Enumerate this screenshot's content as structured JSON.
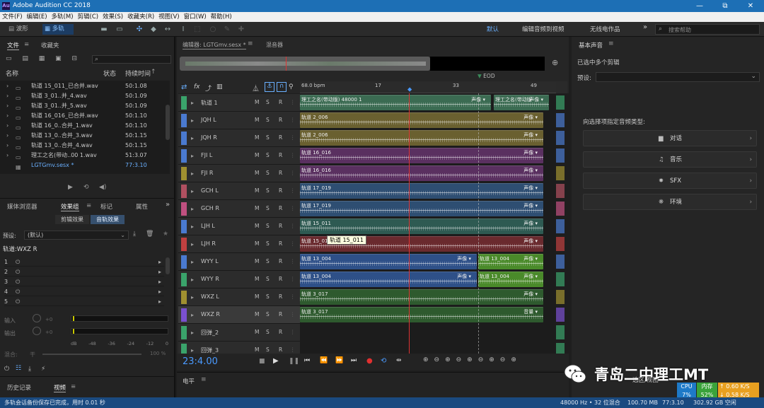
{
  "window": {
    "title": "Adobe Audition CC 2018",
    "app_icon": "Au",
    "minimize": "—",
    "restore": "⧉",
    "close": "✕"
  },
  "menu": [
    "文件(F)",
    "编辑(E)",
    "多轨(M)",
    "剪辑(C)",
    "效果(S)",
    "收藏夹(R)",
    "视图(V)",
    "窗口(W)",
    "帮助(H)"
  ],
  "toolbar": {
    "waveform": "波形",
    "multitrack": "多轨"
  },
  "workspace": {
    "default": "默认",
    "edit_video": "编辑音频到视频",
    "radio": "无线电作品",
    "more": "»",
    "search_placeholder": "搜索帮助"
  },
  "files_panel": {
    "tab_files": "文件",
    "tab_favorites": "收藏夹",
    "col_name": "名称",
    "col_status": "状态",
    "col_duration": "持续时间",
    "items": [
      {
        "name": "轨道 15_011_已合并.wav",
        "duration": "50:1.08"
      },
      {
        "name": "轨道 3_01..并_4.wav",
        "duration": "50:1.09"
      },
      {
        "name": "轨道 3_01..并_5.wav",
        "duration": "50:1.09"
      },
      {
        "name": "轨道 16_016_已合并.wav",
        "duration": "50:1.10"
      },
      {
        "name": "轨道 16_0..合并_1.wav",
        "duration": "50:1.10"
      },
      {
        "name": "轨道 13_0..合并_3.wav",
        "duration": "50:1.15"
      },
      {
        "name": "轨道 13_0..合并_4.wav",
        "duration": "50:1.15"
      },
      {
        "name": "理工之名(带动..00 1.wav",
        "duration": "51:3.07"
      },
      {
        "name": "LGTGmv.sesx *",
        "duration": "77:3.10"
      }
    ]
  },
  "effects_panel": {
    "tab_media": "媒体浏览器",
    "tab_effects": "效果组",
    "tab_markers": "标记",
    "tab_props": "属性",
    "sub_clip": "剪辑效果",
    "sub_track": "音轨效果",
    "preset_label": "预设:",
    "preset_value": "(默认)",
    "track_label": "轨道:WXZ R",
    "slots": [
      "1",
      "2",
      "3",
      "4",
      "5"
    ],
    "input_label": "输入",
    "output_label": "输出",
    "mix_label": "混合:",
    "mix_dry": "干",
    "mix_pct": "100 %",
    "db_ticks": [
      "dB",
      "-48",
      "-36",
      "-24",
      "-12",
      "0"
    ],
    "db_zero": "+0"
  },
  "history_panel": {
    "tab_history": "历史记录",
    "tab_video": "视频"
  },
  "editor": {
    "tab_editor": "编辑器: LGTGmv.sesx *",
    "tab_mixer": "混音器",
    "bpm": "68.0 bpm",
    "ruler": [
      "17",
      "33",
      "49"
    ],
    "eod": "EOD",
    "time": "23:4.00",
    "tooltip": "轨道 15_011"
  },
  "tracks": [
    {
      "name": "轨道 1",
      "color": "#3aa36b"
    },
    {
      "name": "JQH L",
      "color": "#4a7ad0"
    },
    {
      "name": "JQH R",
      "color": "#4a7ad0"
    },
    {
      "name": "FJI L",
      "color": "#4a7ad0"
    },
    {
      "name": "FJI R",
      "color": "#a09030"
    },
    {
      "name": "GCH L",
      "color": "#b05060"
    },
    {
      "name": "GCH R",
      "color": "#c05080"
    },
    {
      "name": "LJH L",
      "color": "#4a7ad0"
    },
    {
      "name": "LJH R",
      "color": "#c04040"
    },
    {
      "name": "WYY L",
      "color": "#4a7ad0"
    },
    {
      "name": "WYY R",
      "color": "#3aa36b"
    },
    {
      "name": "WXZ L",
      "color": "#a09030"
    },
    {
      "name": "WXZ R",
      "color": "#7a50d0"
    },
    {
      "name": "回弹_2",
      "color": "#3aa36b"
    },
    {
      "name": "回弹_3",
      "color": "#3aa36b"
    }
  ],
  "clips": [
    {
      "track": 0,
      "label": "理工之名(带动版)   48000 1",
      "tag": "声像",
      "color": "#3b6b52"
    },
    {
      "track": 1,
      "label": "轨道 2_006",
      "tag": "声像",
      "color": "#6a6030"
    },
    {
      "track": 2,
      "label": "轨道 2_006",
      "tag": "声像",
      "color": "#6a6030"
    },
    {
      "track": 3,
      "label": "轨道 16_016",
      "tag": "声像",
      "color": "#5a3060"
    },
    {
      "track": 4,
      "label": "轨道 16_016",
      "tag": "声像",
      "color": "#5a3060"
    },
    {
      "track": 5,
      "label": "轨道 17_019",
      "tag": "声像",
      "color": "#2e4e72"
    },
    {
      "track": 6,
      "label": "轨道 17_019",
      "tag": "声像",
      "color": "#2e4e72"
    },
    {
      "track": 7,
      "label": "轨道 15_011",
      "tag": "声像",
      "color": "#2e5a52"
    },
    {
      "track": 8,
      "label": "轨道 15_011",
      "tag": "声像",
      "color": "#6a2a2e"
    },
    {
      "track": 9,
      "label": "轨道 13_004",
      "tag": "声像",
      "color": "#2e5088"
    },
    {
      "track": 10,
      "label": "轨道 13_004",
      "tag": "声像",
      "color": "#2e5088"
    },
    {
      "track": 11,
      "label": "轨道 3_017",
      "tag": "声像",
      "color": "#2e5a2e"
    },
    {
      "track": 12,
      "label": "轨道 3_017",
      "tag": "音量",
      "color": "#2e5a2e"
    }
  ],
  "clips2": [
    {
      "track": 0,
      "label": "理工之名(带动版",
      "tag": "声像",
      "color": "#3b6b52"
    },
    {
      "track": 9,
      "label": "轨道 13_004",
      "tag": "声像",
      "color": "#4a8a2a"
    },
    {
      "track": 10,
      "label": "轨道 13_004",
      "tag": "声像",
      "color": "#4a8a2a"
    }
  ],
  "levels_panel": {
    "title": "电平"
  },
  "essential_sound": {
    "title": "基本声音",
    "selected": "已选中多个剪辑",
    "preset_label": "预设:",
    "prompt": "向选择项指定音频类型:",
    "types": [
      "对话",
      "音乐",
      "SFX",
      "环境"
    ],
    "type_icons": [
      "speech-icon",
      "music-icon",
      "sfx-icon",
      "ambience-icon"
    ]
  },
  "selection_panel": {
    "title": "选区/视图"
  },
  "status": {
    "message": "多轨会话备份保存已完成，用时 0.01 秒",
    "sample_rate": "48000 Hz • 32 位混合",
    "size": "100.70 MB",
    "duration": "77:3.10",
    "free": "302.92 GB 空闲"
  },
  "sysmon": {
    "cpu_label": "CPU",
    "cpu_val": "7%",
    "mem_label": "内存",
    "mem_val": "52%",
    "up": "0.60 K/S",
    "down": "0.58 K/S"
  },
  "watermark": {
    "text": "青岛二中理工MT"
  }
}
